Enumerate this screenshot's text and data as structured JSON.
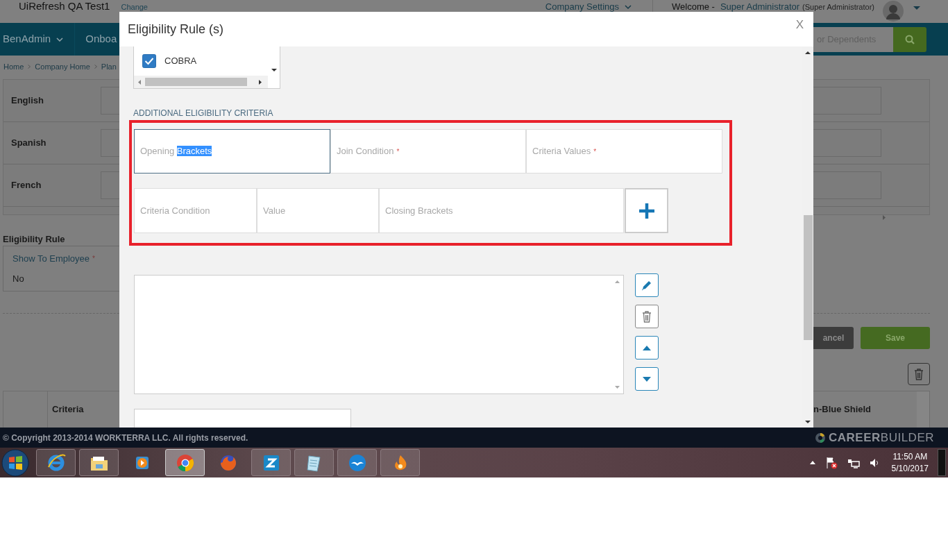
{
  "app_header": {
    "title": "UiRefresh QA Test1",
    "change_link": "Change",
    "company_settings": "Company Settings",
    "welcome": "Welcome -",
    "user": "Super Administrator",
    "role": "(Super Administrator)"
  },
  "nav": {
    "items": [
      {
        "label": "BenAdmin",
        "has_menu": true
      },
      {
        "label": "Onboa",
        "has_menu": false
      }
    ],
    "search_placeholder": "or Dependents"
  },
  "breadcrumb": [
    "Home",
    "Company Home",
    "Plan"
  ],
  "languages": [
    "English",
    "Spanish",
    "French"
  ],
  "eligibility_rule": {
    "heading": "Eligibility Rule",
    "field_label": "Show To Employee",
    "required_marker": "*",
    "value": "No"
  },
  "actions": [
    {
      "label": "ancel",
      "kind": "secondary"
    },
    {
      "label": "Save",
      "kind": "primary"
    }
  ],
  "table": {
    "columns": [
      "Criteria",
      "n-Blue Shield"
    ]
  },
  "modal": {
    "title": "Eligibility Rule (s)",
    "close": "X",
    "options": [
      {
        "label": "COBRA",
        "checked": true
      }
    ],
    "section_heading": "ADDITIONAL ELIGIBILITY CRITERIA",
    "criteria_rows": [
      [
        {
          "label": "Opening",
          "selected_label": "Brackets",
          "focused": true
        },
        {
          "label": "Join Condition",
          "required_marker": "*",
          "focused": false
        },
        {
          "label": "Criteria Values",
          "required_marker": "*",
          "focused": false
        }
      ],
      [
        {
          "label": "Criteria Condition",
          "focused": false
        },
        {
          "label": "Value",
          "focused": false
        },
        {
          "label": "Closing Brackets",
          "focused": false
        }
      ]
    ],
    "side_buttons": [
      {
        "kind": "edit"
      },
      {
        "kind": "delete"
      },
      {
        "kind": "up"
      },
      {
        "kind": "down"
      }
    ]
  },
  "footer": {
    "copyright": "© Copyright 2013-2014 WORKTERRA LLC. All rights reserved.",
    "brand_bold": "CAREER",
    "brand_light": "BUILDER"
  },
  "taskbar": {
    "apps": [
      {
        "kind": "ie",
        "running": true,
        "selected": false
      },
      {
        "kind": "explorer",
        "running": true,
        "selected": false
      },
      {
        "kind": "media",
        "running": false,
        "selected": false
      },
      {
        "kind": "chrome",
        "running": true,
        "selected": true
      },
      {
        "kind": "firefox",
        "running": false,
        "selected": false
      },
      {
        "kind": "z",
        "running": true,
        "selected": false
      },
      {
        "kind": "notepad",
        "running": true,
        "selected": false
      },
      {
        "kind": "office",
        "running": true,
        "selected": false
      },
      {
        "kind": "flame",
        "running": true,
        "selected": false
      }
    ],
    "time": "11:50 AM",
    "date": "5/10/2017"
  }
}
